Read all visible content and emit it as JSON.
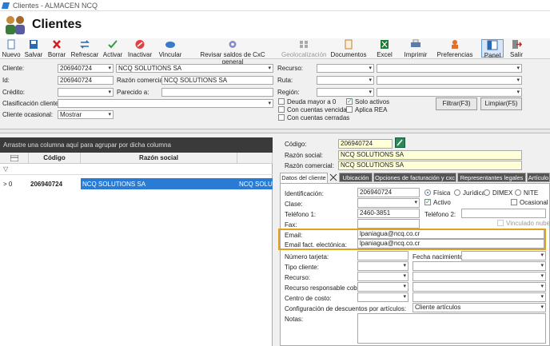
{
  "window": {
    "title": "Clientes - ALMACEN NCQ"
  },
  "header": {
    "title": "Clientes"
  },
  "toolbar": {
    "nuevo": "Nuevo",
    "salvar": "Salvar",
    "borrar": "Borrar",
    "refrescar": "Refrescar",
    "activar": "Activar",
    "inactivar": "Inactivar",
    "vincular": "Vincular",
    "revisar": "Revisar saldos de CxC general",
    "geolocalizacion": "Geolocalización",
    "documentos": "Documentos",
    "excel": "Excel",
    "imprimir": "Imprimir",
    "preferencias": "Preferencias",
    "panel": "Panel",
    "salir": "Salir"
  },
  "filters": {
    "cliente_label": "Cliente:",
    "cliente_value": "206940724",
    "cliente_name": "NCQ SOLUTIONS SA",
    "id_label": "Id:",
    "id_value": "206940724",
    "razon_label": "Razón comercial:",
    "razon_value": "NCQ SOLUTIONS SA",
    "credito_label": "Crédito:",
    "parecido_label": "Parecido a:",
    "clasificacion_label": "Clasificación cliente:",
    "ocasional_label": "Cliente ocasional:",
    "ocasional_value": "Mostrar",
    "recurso_label": "Recurso:",
    "ruta_label": "Ruta:",
    "region_label": "Región:",
    "deuda": "Deuda mayor a 0",
    "solo_activos": "Solo activos",
    "vencidas": "Con cuentas vencidas",
    "aplica_rea": "Aplica REA",
    "cerradas": "Con cuentas cerradas",
    "filtrar": "Filtrar(F3)",
    "limpiar": "Limpiar(F5)"
  },
  "grid": {
    "group_hint": "Arrastre una columna aquí para agrupar por dicha columna",
    "col_codigo": "Código",
    "col_razon": "Razón social",
    "filter_icon": "▽",
    "row_indicator": "> 0",
    "row": {
      "codigo": "206940724",
      "razon": "NCQ SOLUTIONS SA",
      "extra": "NCQ SOLUTIONS"
    }
  },
  "detail": {
    "codigo_label": "Código:",
    "codigo_value": "206940724",
    "razon_social_label": "Razón social:",
    "razon_social_value": "NCQ SOLUTIONS SA",
    "razon_comercial_label": "Razón comercial:",
    "razon_comercial_value": "NCQ SOLUTIONS SA",
    "tabs": [
      "Datos del cliente",
      "Ubicación",
      "Opciones de facturación y cxc",
      "Representantes legales",
      "Artículo"
    ],
    "identificacion_label": "Identificación:",
    "identificacion_value": "206940724",
    "fisica": "Física",
    "juridica": "Jurídica",
    "dimex": "DIMEX",
    "nite": "NITE",
    "clase_label": "Clase:",
    "activo": "Activo",
    "ocasional": "Ocasional",
    "telefono1_label": "Teléfono 1:",
    "telefono1_value": "2460-3851",
    "telefono2_label": "Teléfono 2:",
    "fax_label": "Fax:",
    "vinculado": "Vinculado nube",
    "email_label": "Email:",
    "email_value": "lpaniagua@ncq.co.cr",
    "email_fact_label": "Email fact. electónica:",
    "email_fact_value": "lpaniagua@ncq.co.cr",
    "numero_tarjeta": "Número tarjeta:",
    "fecha_nacimiento": "Fecha nacimiento:",
    "tipo_cliente": "Tipo cliente:",
    "recurso": "Recurso:",
    "recurso_resp": "Recurso responsable cobro:",
    "centro_costo": "Centro de costo:",
    "config_desc": "Configuración de descuentos por artículos:",
    "config_value": "Cliente artículos",
    "notas": "Notas:"
  },
  "colors": {
    "accent": "#2a7bd4",
    "highlight": "#e0a020",
    "grid_header": "#3a3a3a"
  }
}
